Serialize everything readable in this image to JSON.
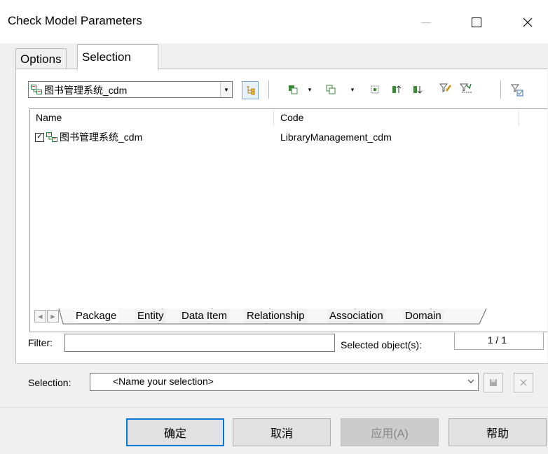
{
  "window": {
    "title": "Check Model Parameters"
  },
  "tabs": [
    {
      "label": "Options"
    },
    {
      "label": "Selection"
    }
  ],
  "model_combo": {
    "value": "图书管理系统_cdm"
  },
  "list": {
    "columns": [
      "Name",
      "Code"
    ],
    "rows": [
      {
        "name": "图书管理系统_cdm",
        "code": "LibraryManagement_cdm",
        "checked": true
      }
    ]
  },
  "subtabs": [
    "Package",
    "Entity",
    "Data Item",
    "Relationship",
    "Association",
    "Domain"
  ],
  "filter": {
    "label": "Filter:",
    "value": ""
  },
  "selected_objects": {
    "label": "Selected object(s):",
    "value": "1 / 1"
  },
  "selection": {
    "label": "Selection:",
    "placeholder": "<Name your selection>"
  },
  "buttons": {
    "ok": "确定",
    "cancel": "取消",
    "apply": "应用(A)",
    "help": "帮助"
  }
}
